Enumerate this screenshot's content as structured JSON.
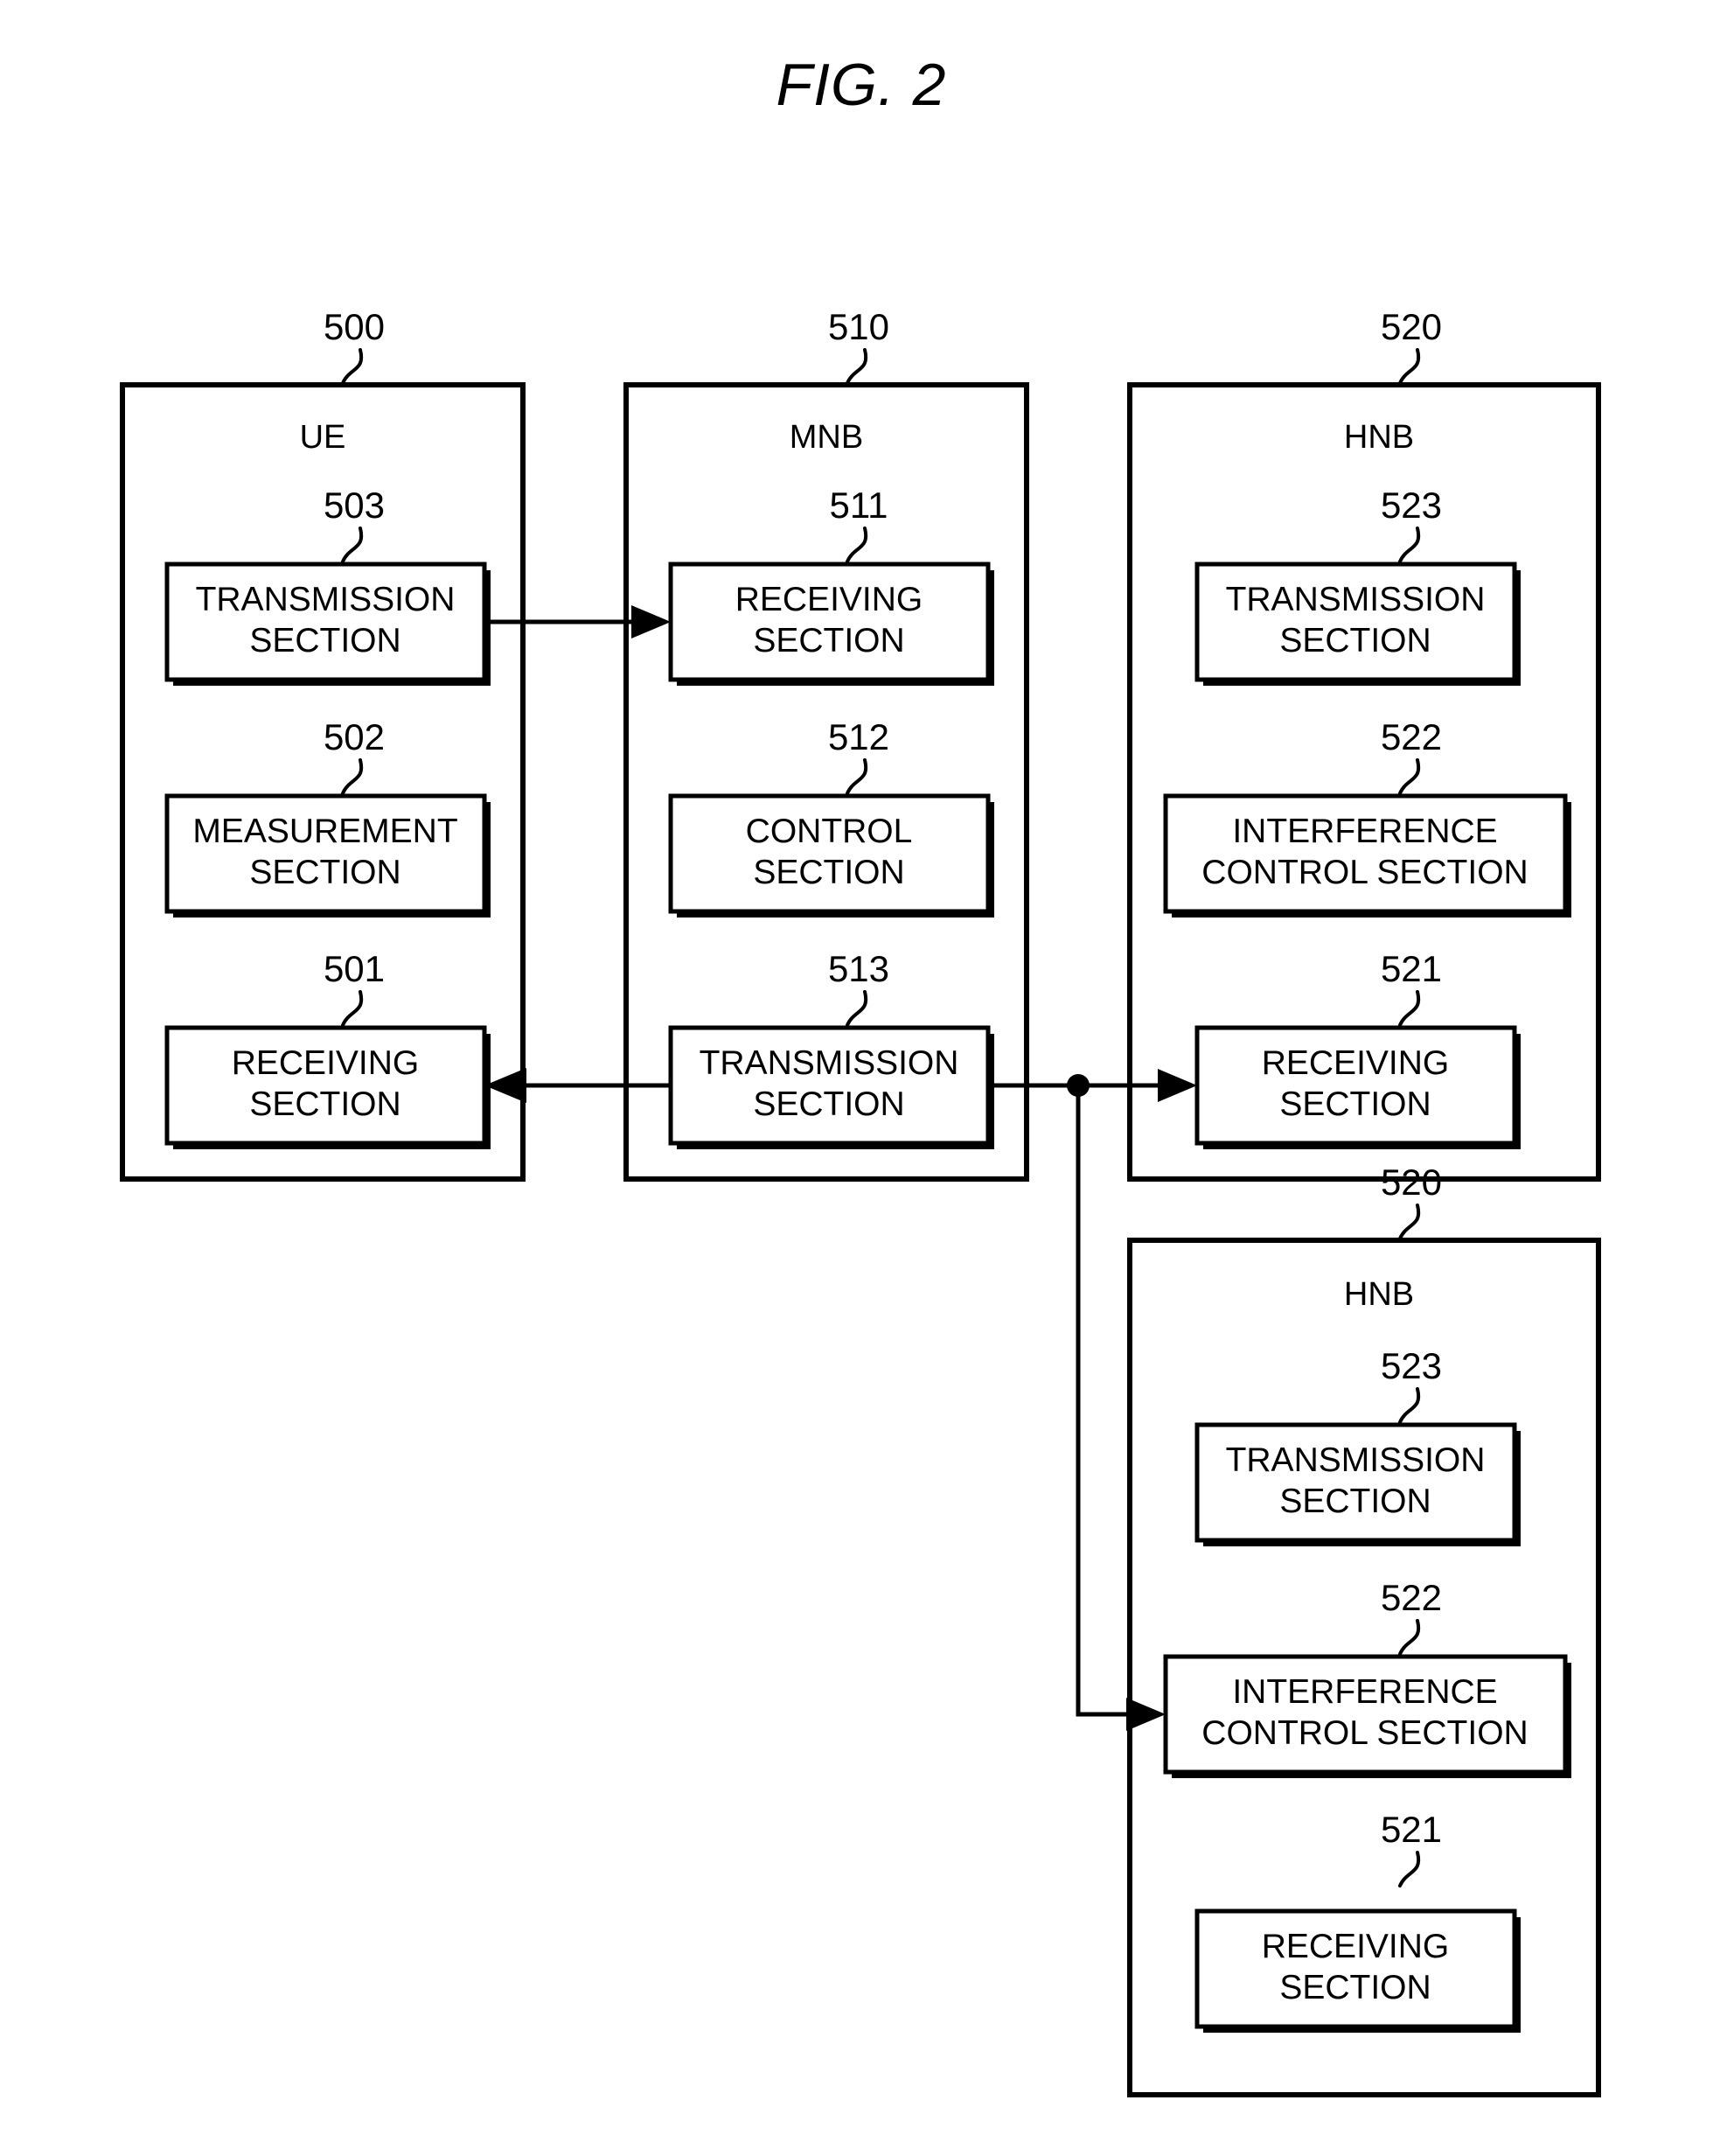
{
  "figure": {
    "title": "FIG. 2"
  },
  "blocks": [
    {
      "ref": "500",
      "title": "UE",
      "sections": [
        {
          "ref": "503",
          "label_line1": "TRANSMISSION",
          "label_line2": "SECTION"
        },
        {
          "ref": "502",
          "label_line1": "MEASUREMENT",
          "label_line2": "SECTION"
        },
        {
          "ref": "501",
          "label_line1": "RECEIVING",
          "label_line2": "SECTION"
        }
      ]
    },
    {
      "ref": "510",
      "title": "MNB",
      "sections": [
        {
          "ref": "511",
          "label_line1": "RECEIVING",
          "label_line2": "SECTION"
        },
        {
          "ref": "512",
          "label_line1": "CONTROL",
          "label_line2": "SECTION"
        },
        {
          "ref": "513",
          "label_line1": "TRANSMISSION",
          "label_line2": "SECTION"
        }
      ]
    },
    {
      "ref": "520",
      "title": "HNB",
      "sections": [
        {
          "ref": "523",
          "label_line1": "TRANSMISSION",
          "label_line2": "SECTION"
        },
        {
          "ref": "522",
          "label_line1": "INTERFERENCE",
          "label_line2": "CONTROL SECTION"
        },
        {
          "ref": "521",
          "label_line1": "RECEIVING",
          "label_line2": "SECTION"
        }
      ]
    },
    {
      "ref": "520",
      "title": "HNB",
      "sections": [
        {
          "ref": "523",
          "label_line1": "TRANSMISSION",
          "label_line2": "SECTION"
        },
        {
          "ref": "522",
          "label_line1": "INTERFERENCE",
          "label_line2": "CONTROL SECTION"
        },
        {
          "ref": "521",
          "label_line1": "RECEIVING",
          "label_line2": "SECTION"
        }
      ]
    }
  ],
  "colors": {
    "ink": "#000000",
    "paper": "#ffffff"
  }
}
